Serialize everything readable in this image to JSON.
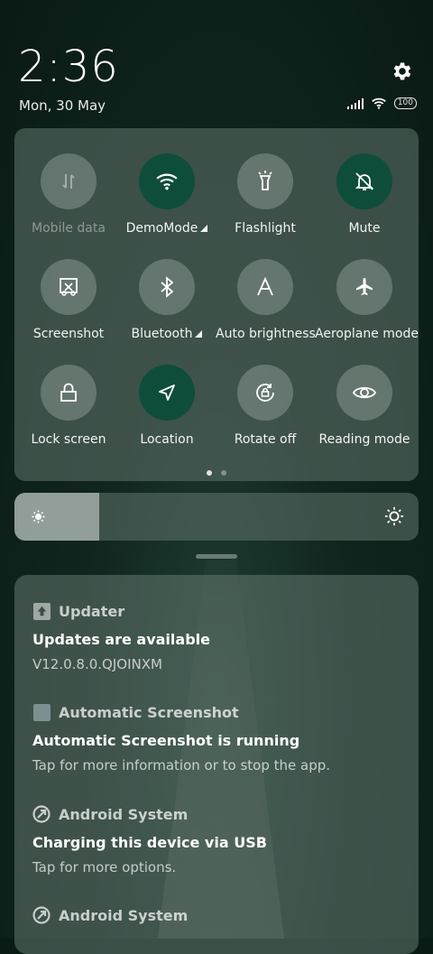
{
  "status": {
    "time": "2:36",
    "date": "Mon, 30 May",
    "battery": "100"
  },
  "quick_settings": {
    "tiles": [
      {
        "label": "Mobile data",
        "icon": "mobile-data-icon",
        "active": false,
        "disabled": true
      },
      {
        "label": "DemoMode",
        "icon": "wifi-icon",
        "active": true,
        "has_more": true
      },
      {
        "label": "Flashlight",
        "icon": "flashlight-icon",
        "active": false
      },
      {
        "label": "Mute",
        "icon": "mute-bell-icon",
        "active": true
      },
      {
        "label": "Screenshot",
        "icon": "screenshot-icon",
        "active": false
      },
      {
        "label": "Bluetooth",
        "icon": "bluetooth-icon",
        "active": false,
        "has_more": true
      },
      {
        "label": "Auto brightness",
        "icon": "auto-brightness-icon",
        "active": false
      },
      {
        "label": "Aeroplane mode",
        "icon": "aeroplane-icon",
        "active": false
      },
      {
        "label": "Lock screen",
        "icon": "lock-icon",
        "active": false
      },
      {
        "label": "Location",
        "icon": "location-icon",
        "active": true
      },
      {
        "label": "Rotate off",
        "icon": "rotate-lock-icon",
        "active": false
      },
      {
        "label": "Reading mode",
        "icon": "eye-icon",
        "active": false
      }
    ],
    "page_count": 2,
    "current_page": 1
  },
  "brightness": {
    "level": 0.21
  },
  "notifications": [
    {
      "app": "Updater",
      "title": "Updates are available",
      "text": "V12.0.8.0.QJOINXM"
    },
    {
      "app": "Automatic Screenshot",
      "title": "Automatic Screenshot is running",
      "text": "Tap for more information or to stop the app."
    },
    {
      "app": "Android System",
      "title": "Charging this device via USB",
      "text": "Tap for more options."
    },
    {
      "app": "Android System",
      "title": "",
      "text": ""
    }
  ],
  "colors": {
    "active_tile": "#0f4d3b",
    "panel": "#586c64"
  }
}
